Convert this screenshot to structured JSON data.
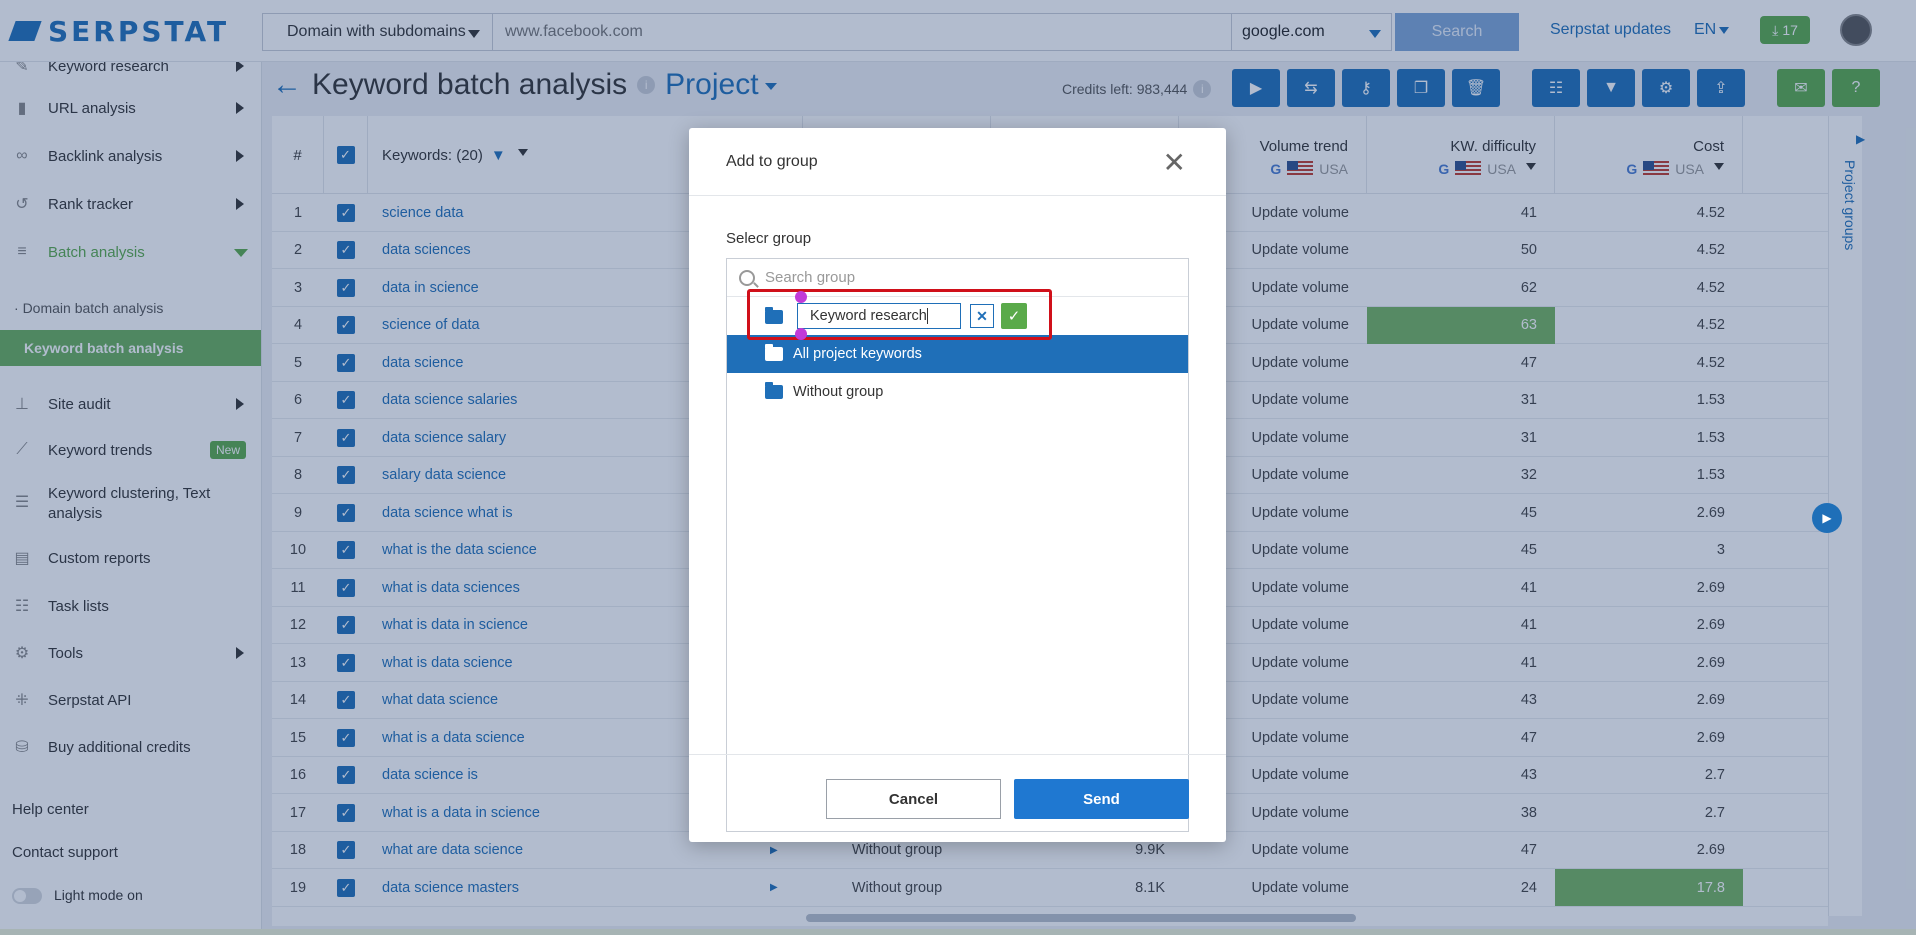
{
  "topbar": {
    "logo_text": "SERPSTAT",
    "domain_scope": "Domain with subdomains",
    "domain_placeholder": "www.facebook.com",
    "engine": "google.com",
    "search_label": "Search",
    "updates_label": "Serpstat updates",
    "lang": "EN",
    "downloads_count": "17"
  },
  "sidebar": {
    "items": [
      {
        "label": "Keyword research"
      },
      {
        "label": "URL analysis"
      },
      {
        "label": "Backlink analysis"
      },
      {
        "label": "Rank tracker"
      },
      {
        "label": "Batch analysis"
      },
      {
        "label": "Domain batch analysis"
      },
      {
        "label": "Keyword batch analysis"
      },
      {
        "label": "Site audit"
      },
      {
        "label": "Keyword trends",
        "badge": "New"
      },
      {
        "label": "Keyword clustering, Text analysis"
      },
      {
        "label": "Custom reports"
      },
      {
        "label": "Task lists"
      },
      {
        "label": "Tools"
      },
      {
        "label": "Serpstat API"
      },
      {
        "label": "Buy additional credits"
      }
    ],
    "help_center": "Help center",
    "contact_support": "Contact support",
    "light_mode": "Light mode on"
  },
  "page": {
    "title": "Keyword batch analysis",
    "project": "Project",
    "credits": "Credits left: 983,444"
  },
  "table": {
    "headers": {
      "num": "#",
      "keywords": "Keywords: (20)",
      "volume_trend": "Volume trend",
      "kw_difficulty": "KW. difficulty",
      "cost": "Cost",
      "region": "USA"
    },
    "rows": [
      {
        "n": "1",
        "kw": "science data",
        "trend": "Update volume",
        "diff": "41",
        "cost": "4.52"
      },
      {
        "n": "2",
        "kw": "data sciences",
        "trend": "Update volume",
        "diff": "50",
        "cost": "4.52"
      },
      {
        "n": "3",
        "kw": "data in science",
        "trend": "Update volume",
        "diff": "62",
        "cost": "4.52"
      },
      {
        "n": "4",
        "kw": "science of data",
        "trend": "Update volume",
        "diff": "63",
        "cost": "4.52"
      },
      {
        "n": "5",
        "kw": "data science",
        "trend": "Update volume",
        "diff": "47",
        "cost": "4.52"
      },
      {
        "n": "6",
        "kw": "data science salaries",
        "trend": "Update volume",
        "diff": "31",
        "cost": "1.53"
      },
      {
        "n": "7",
        "kw": "data science salary",
        "trend": "Update volume",
        "diff": "31",
        "cost": "1.53"
      },
      {
        "n": "8",
        "kw": "salary data science",
        "trend": "Update volume",
        "diff": "32",
        "cost": "1.53"
      },
      {
        "n": "9",
        "kw": "data science what is",
        "trend": "Update volume",
        "diff": "45",
        "cost": "2.69"
      },
      {
        "n": "10",
        "kw": "what is the data science",
        "trend": "Update volume",
        "diff": "45",
        "cost": "3"
      },
      {
        "n": "11",
        "kw": "what is data sciences",
        "trend": "Update volume",
        "diff": "41",
        "cost": "2.69"
      },
      {
        "n": "12",
        "kw": "what is data in science",
        "trend": "Update volume",
        "diff": "41",
        "cost": "2.69"
      },
      {
        "n": "13",
        "kw": "what is data science",
        "trend": "Update volume",
        "diff": "41",
        "cost": "2.69"
      },
      {
        "n": "14",
        "kw": "what data science",
        "trend": "Update volume",
        "diff": "43",
        "cost": "2.69"
      },
      {
        "n": "15",
        "kw": "what is a data science",
        "trend": "Update volume",
        "diff": "47",
        "cost": "2.69"
      },
      {
        "n": "16",
        "kw": "data science is",
        "trend": "Update volume",
        "diff": "43",
        "cost": "2.7"
      },
      {
        "n": "17",
        "kw": "what is a data in science",
        "trend": "Update volume",
        "diff": "38",
        "cost": "2.7"
      },
      {
        "n": "18",
        "kw": "what are data science",
        "group": "Without group",
        "vol": "9.9K",
        "trend": "Update volume",
        "diff": "47",
        "cost": "2.69"
      },
      {
        "n": "19",
        "kw": "data science masters",
        "group": "Without group",
        "vol": "8.1K",
        "trend": "Update volume",
        "diff": "24",
        "cost": "17.8"
      }
    ]
  },
  "right_rail": {
    "label": "Project groups"
  },
  "modal": {
    "title": "Add to group",
    "select_label": "Selecr group",
    "search_placeholder": "Search group",
    "new_group_value": "Keyword research",
    "groups": [
      "All project keywords",
      "Without group"
    ],
    "cancel_label": "Cancel",
    "send_label": "Send"
  },
  "colors": {
    "accent": "#1f6fb8",
    "green": "#5aaa4a",
    "highlight": "#d0101a"
  }
}
